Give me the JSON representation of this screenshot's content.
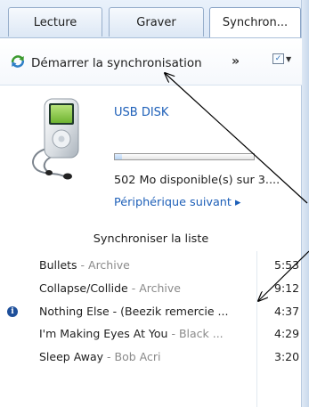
{
  "tabs": [
    {
      "label": "Lecture"
    },
    {
      "label": "Graver"
    },
    {
      "label": "Synchron..."
    }
  ],
  "toolbar": {
    "sync_label": "Démarrer la synchronisation",
    "more_label": "»",
    "options_icon": "check-list-icon"
  },
  "device": {
    "name": "USB DISK",
    "free_space": "502 Mo disponible(s) sur 3....",
    "next_label": "Périphérique suivant ▸",
    "used_fraction": 0.05
  },
  "sync_list": {
    "header": "Synchroniser la liste",
    "items": [
      {
        "title": "Bullets",
        "subtitle": " - Archive",
        "duration": "5:53",
        "icon": ""
      },
      {
        "title": "Collapse/Collide",
        "subtitle": " - Archive",
        "duration": "9:12",
        "icon": ""
      },
      {
        "title": "Nothing Else - (Beezik remercie ...",
        "subtitle": "",
        "duration": "4:37",
        "icon": "info-icon"
      },
      {
        "title": "I'm Making Eyes At You",
        "subtitle": " - Black ...",
        "duration": "4:29",
        "icon": ""
      },
      {
        "title": "Sleep Away",
        "subtitle": " - Bob Acri",
        "duration": "3:20",
        "icon": ""
      }
    ]
  },
  "colors": {
    "link": "#1d5fb8",
    "muted": "#8a8a8a",
    "tab_border": "#97aecb"
  }
}
